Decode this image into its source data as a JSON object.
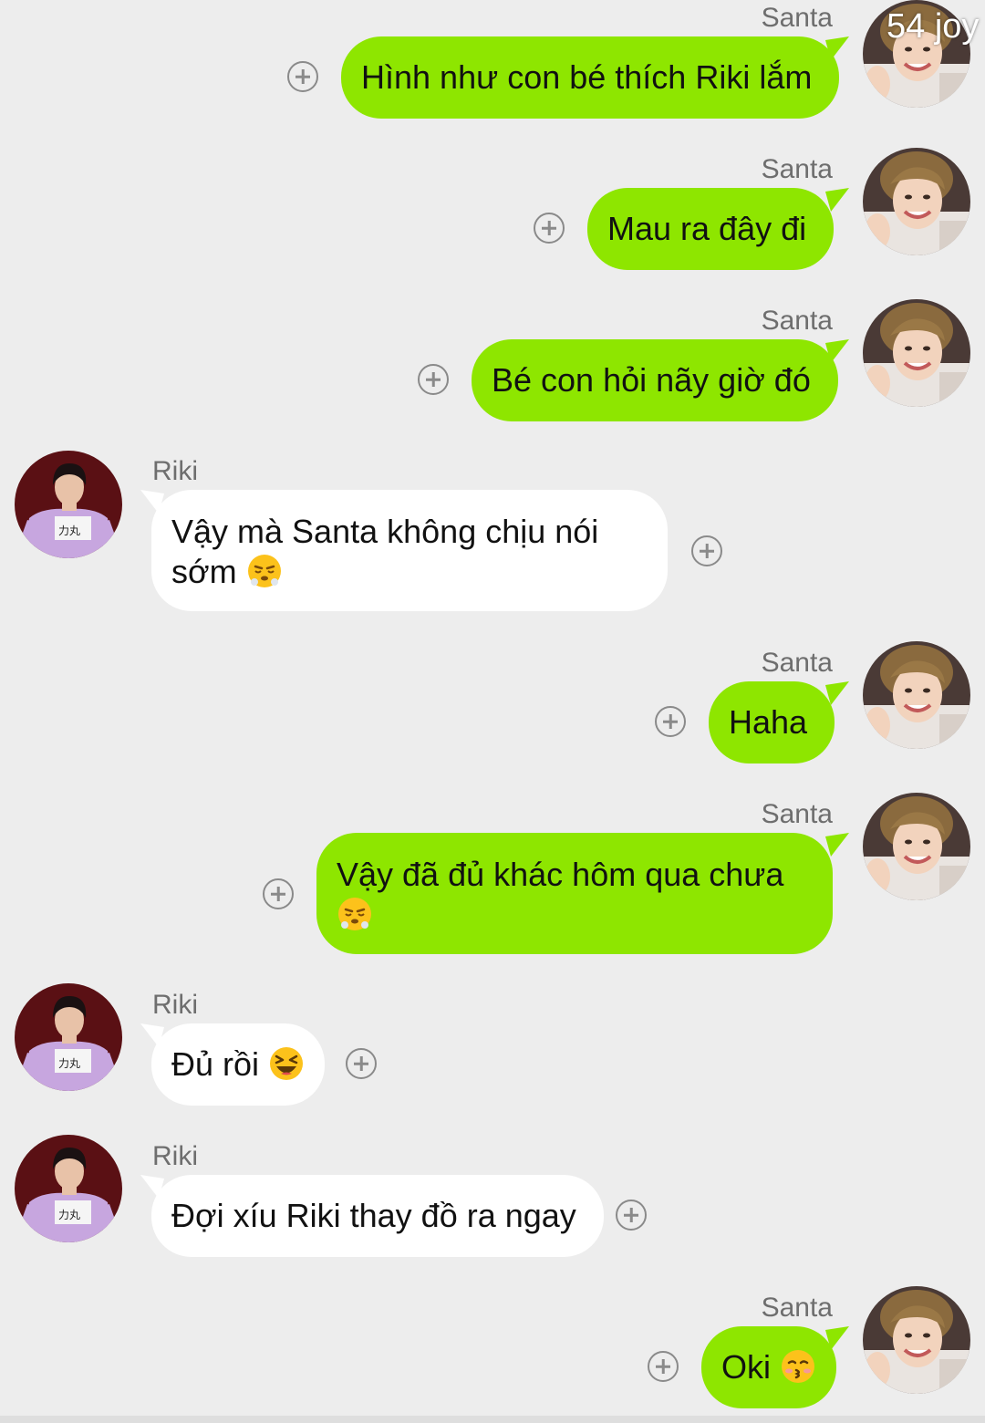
{
  "overlay_text": "54 joy",
  "colors": {
    "background": "#ededed",
    "sent_bubble": "#8ee600",
    "received_bubble": "#ffffff",
    "name_text": "#6e6e6e",
    "plus_icon": "#8a8a8a"
  },
  "messages": [
    {
      "sender": "Santa",
      "direction": "sent",
      "text": "Hình như con bé thích Riki lắm"
    },
    {
      "sender": "Santa",
      "direction": "sent",
      "text": "Mau ra đây đi"
    },
    {
      "sender": "Santa",
      "direction": "sent",
      "text": "Bé con hỏi nãy giờ đó"
    },
    {
      "sender": "Riki",
      "direction": "received",
      "text_line1": "Vậy mà Santa không chịu nói",
      "text_line2": "sớm",
      "emoji": "huffing-face-emoji"
    },
    {
      "sender": "Santa",
      "direction": "sent",
      "text": "Haha"
    },
    {
      "sender": "Santa",
      "direction": "sent",
      "text": "Vậy đã đủ khác hôm qua chưa",
      "emoji": "huffing-face-emoji"
    },
    {
      "sender": "Riki",
      "direction": "received",
      "text": "Đủ rồi",
      "emoji": "laughing-squint-face-emoji"
    },
    {
      "sender": "Riki",
      "direction": "received",
      "text": "Đợi xíu Riki thay đồ ra ngay"
    },
    {
      "sender": "Santa",
      "direction": "sent",
      "text": "Oki",
      "emoji": "kissing-face-emoji"
    }
  ]
}
